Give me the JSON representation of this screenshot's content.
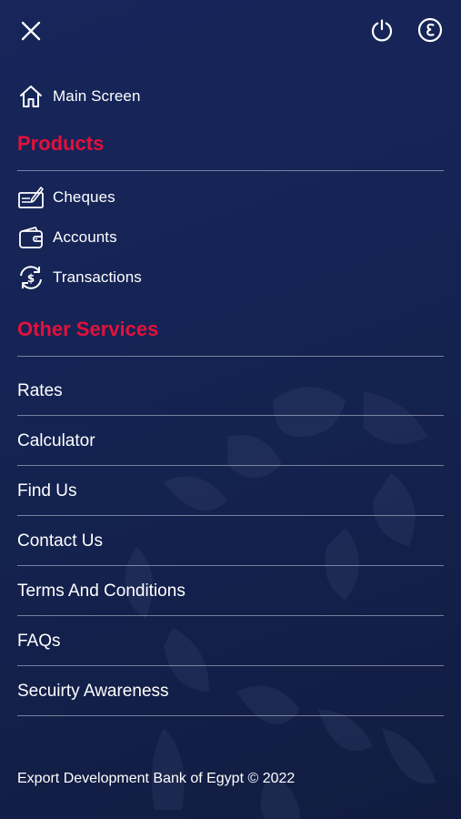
{
  "topbar": {
    "close_icon": "close-icon",
    "power_icon": "power-icon",
    "language_icon": "egyptian-pound-icon"
  },
  "main_screen": {
    "label": "Main Screen",
    "icon": "home-icon"
  },
  "products": {
    "title": "Products",
    "items": [
      {
        "label": "Cheques",
        "icon": "cheque-icon"
      },
      {
        "label": "Accounts",
        "icon": "wallet-icon"
      },
      {
        "label": "Transactions",
        "icon": "exchange-icon"
      }
    ]
  },
  "other_services": {
    "title": "Other Services",
    "items": [
      {
        "label": "Rates"
      },
      {
        "label": "Calculator"
      },
      {
        "label": "Find Us"
      },
      {
        "label": "Contact Us"
      },
      {
        "label": "Terms And Conditions"
      },
      {
        "label": "FAQs"
      },
      {
        "label": "Secuirty Awareness"
      }
    ]
  },
  "footer": {
    "text": "Export Development Bank of Egypt © 2022"
  },
  "colors": {
    "accent": "#e5103a",
    "background": "#152455",
    "divider": "#c8cde1"
  }
}
